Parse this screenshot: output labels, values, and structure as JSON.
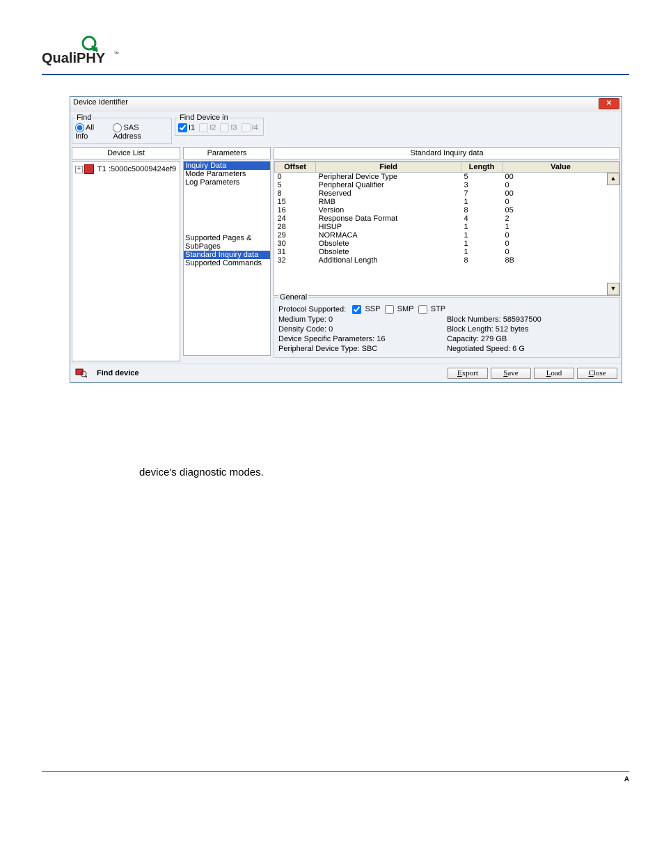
{
  "logo_text": "QualiPHY",
  "dialog": {
    "title": "Device Identifier",
    "find": {
      "legend": "Find",
      "opt_all": "All Info",
      "opt_sas": "SAS Address"
    },
    "find_in": {
      "legend": "Find Device in",
      "i1": "I1",
      "i2": "I2",
      "i3": "I3",
      "i4": "I4"
    },
    "device_list_header": "Device List",
    "device_list_item": "T1 :5000c50009424ef9",
    "parameters_header": "Parameters",
    "params": {
      "inquiry": "Inquiry Data",
      "mode": "Mode Parameters",
      "log": "Log Parameters",
      "supported_pages": "Supported Pages & SubPages",
      "std_inquiry": "Standard Inquiry data",
      "supported_cmds": "Supported Commands"
    },
    "table_title": "Standard Inquiry data",
    "table_headers": {
      "offset": "Offset",
      "field": "Field",
      "length": "Length",
      "value": "Value"
    },
    "rows": [
      {
        "offset": "0",
        "field": "Peripheral Device Type",
        "length": "5",
        "value": "00"
      },
      {
        "offset": "5",
        "field": "Peripheral Qualifier",
        "length": "3",
        "value": "0"
      },
      {
        "offset": "8",
        "field": "Reserved",
        "length": "7",
        "value": "00"
      },
      {
        "offset": "15",
        "field": "RMB",
        "length": "1",
        "value": "0"
      },
      {
        "offset": "16",
        "field": "Version",
        "length": "8",
        "value": "05"
      },
      {
        "offset": "24",
        "field": "Response Data Format",
        "length": "4",
        "value": "2"
      },
      {
        "offset": "28",
        "field": "HISUP",
        "length": "1",
        "value": "1"
      },
      {
        "offset": "29",
        "field": "NORMACA",
        "length": "1",
        "value": "0"
      },
      {
        "offset": "30",
        "field": "Obsolete",
        "length": "1",
        "value": "0"
      },
      {
        "offset": "31",
        "field": "Obsolete",
        "length": "1",
        "value": "0"
      },
      {
        "offset": "32",
        "field": "Additional Length",
        "length": "8",
        "value": "8B"
      }
    ],
    "general": {
      "legend": "General",
      "protocol_label": "Protocol Supported:",
      "ssp": "SSP",
      "smp": "SMP",
      "stp": "STP",
      "medium": "Medium Type: 0",
      "density": "Density Code: 0",
      "device_specific": "Device Specific Parameters: 16",
      "periph_type": "Peripheral Device Type: SBC",
      "block_numbers": "Block Numbers: 585937500",
      "block_length": "Block Length: 512 bytes",
      "capacity": "Capacity: 279 GB",
      "negotiated": "Negotiated Speed: 6 G"
    },
    "find_device_btn": "Find device",
    "buttons": {
      "export": "Export",
      "save": "Save",
      "load": "Load",
      "close": "Close"
    }
  },
  "body_text": "device's diagnostic modes.",
  "footer": "A"
}
